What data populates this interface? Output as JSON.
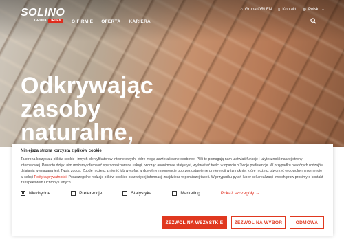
{
  "brand": {
    "name": "SOLINO",
    "group": "GRUPA",
    "group_brand": "ORLEN"
  },
  "nav": [
    "O FIRMIE",
    "OFERTA",
    "KARIERA"
  ],
  "topbar": [
    {
      "icon": "home-icon",
      "label": "Grupa ORLEN"
    },
    {
      "icon": "phone-icon",
      "label": "Kontakt"
    },
    {
      "icon": "globe-icon",
      "label": "Polski"
    }
  ],
  "hero": {
    "line1": "Odkrywając",
    "line2": "zasoby",
    "line3": "naturalne,"
  },
  "cookie": {
    "title": "Niniejsza strona korzysta z plików cookie",
    "text_before": "Ta strona korzysta z plików cookie i innych identyfikatorów internetowych, które mogą zawierać dane osobowe. Pliki te pomagają nam ułatwiać funkcje i użyteczność naszej strony internetowej. Ponadto dzięki nim możemy oferować spersonalizowane usługi, tworząc anonimowe statystyki, wyświetlać treści w oparciu o Twoje preferencje. W przypadku niektórych rodzajów działania wymagana jest Twoja zgoda. Zgodę możesz zmienić lub wycofać w dowolnym momencie poprzez ustawienie preferencji w tym oknie, które możesz otworzyć w dowolnym momencie w sekcji ",
    "link": "Polityka prywatności",
    "text_after": ". Poszczególne rodzaje plików cookies oraz więcej informacji znajdziesz w poniższej tabeli. W przypadku pytań lub w celu realizacji swoich praw prosimy o kontakt z Inspektorem Ochrony Danych.",
    "checks": [
      {
        "label": "Niezbędne",
        "checked": true
      },
      {
        "label": "Preferencje",
        "checked": false
      },
      {
        "label": "Statystyka",
        "checked": false
      },
      {
        "label": "Marketing",
        "checked": false
      }
    ],
    "details": "Pokaż szczegóły →",
    "buttons": {
      "accept_all": "ZEZWÓL NA WSZYSTKIE",
      "accept_selected": "ZEZWÓL NA WYBÓR",
      "deny": "ODMOWA"
    }
  },
  "colors": {
    "accent": "#e0381f"
  }
}
